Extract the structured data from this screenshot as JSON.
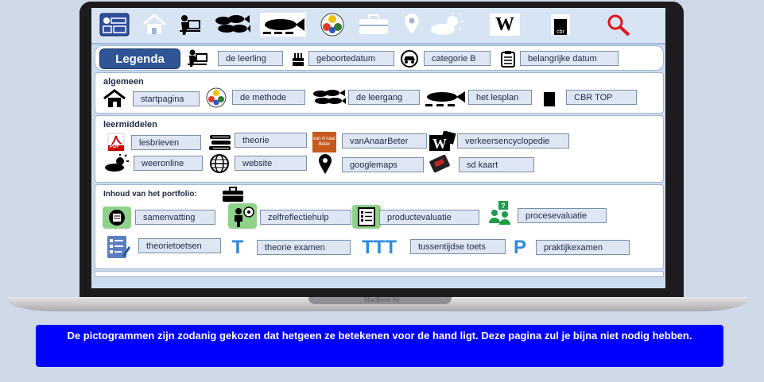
{
  "laptop": {
    "brand": "MacBook Air"
  },
  "topbar": {
    "icons": [
      "menu-icon",
      "home-icon",
      "student-desk-icon",
      "fish-school-icon",
      "fish-plan-icon",
      "method-wheel-icon",
      "briefcase-icon",
      "location-pin-icon",
      "weather-icon",
      "w-logo-icon",
      "cbr-logo-icon",
      "search-icon"
    ],
    "wordmark": "W",
    "cbr_text": "cbr"
  },
  "legend": {
    "title": "Legenda",
    "items": [
      "de leerling",
      "geboortedatum",
      "categorie B",
      "belangrijke datum"
    ]
  },
  "algemeen": {
    "title": "algemeen",
    "items": [
      "startpagina",
      "de methode",
      "de leergang",
      "het lesplan",
      "CBR TOP"
    ]
  },
  "leermiddelen": {
    "title": "leermiddelen",
    "items": [
      "lesbrieven",
      "theorie",
      "vanAnaarBeter",
      "verkeersencyclopedie",
      "weeronline",
      "website",
      "googlemaps",
      "sd kaart"
    ],
    "pdf_label": "PDF",
    "vanabeter_badge": "van A naar Beter"
  },
  "portfolio": {
    "title": "Inhoud van het portfolio:",
    "items": [
      "samenvatting",
      "zelfreflectiehulp",
      "productevaluatie",
      "procesevaluatie",
      "theorietoetsen",
      "theorie examen",
      "tussentijdse toets",
      "praktijkexamen"
    ],
    "letters": [
      "T",
      "TTT",
      "P"
    ]
  },
  "caption": "De pictogrammen zijn zodanig gekozen dat hetgeen ze betekenen voor de hand ligt. Deze pagina zul je bijna niet nodig hebben.",
  "colors": {
    "accent": "#2f5597",
    "caption_bg": "#0000ff",
    "letter_blue": "#2e8ae0"
  }
}
